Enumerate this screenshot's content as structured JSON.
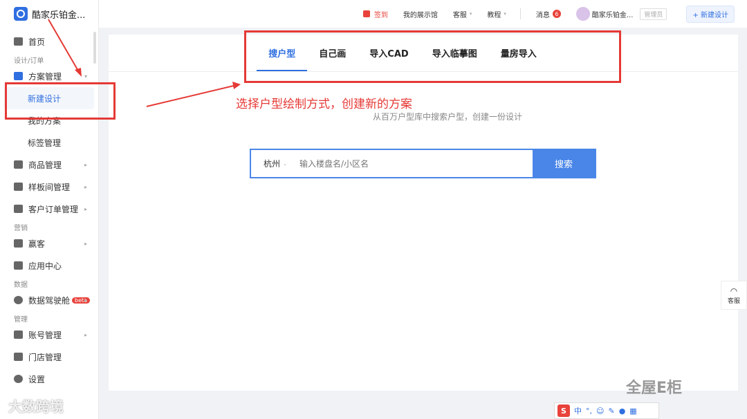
{
  "sidebar": {
    "brand": "酷家乐铂金...",
    "home": "首页",
    "group_design": "设计/订单",
    "plan_mgmt": "方案管理",
    "new_design": "新建设计",
    "my_plans": "我的方案",
    "tag_mgmt": "标签管理",
    "goods_mgmt": "商品管理",
    "sample_mgmt": "样板间管理",
    "customer_orders": "客户订单管理",
    "group_marketing": "营销",
    "yingke": "赢客",
    "app_center": "应用中心",
    "group_data": "数据",
    "data_cockpit": "数据驾驶舱",
    "beta": "beta",
    "group_manage": "管理",
    "account_mgmt": "账号管理",
    "store_mgmt": "门店管理",
    "settings": "设置"
  },
  "topbar": {
    "checkin": "签到",
    "showroom": "我的展示馆",
    "support": "客服",
    "tutorial": "教程",
    "messages": "消息",
    "message_count": "6",
    "user": "酷家乐铂金...",
    "role": "管理员",
    "new_design": "+ 新建设计"
  },
  "tabs": [
    "搜户型",
    "自己画",
    "导入CAD",
    "导入临摹图",
    "量房导入"
  ],
  "subtitle": "从百万户型库中搜索户型，创建一份设计",
  "search": {
    "city": "杭州",
    "placeholder": "输入楼盘名/小区名",
    "button": "搜索"
  },
  "annotation": "选择户型绘制方式，创建新的方案",
  "float_support": "客服",
  "ime": {
    "lang": "中"
  },
  "watermark_left": "大数跨境",
  "watermark_right": "全屋E柜",
  "colors": {
    "accent": "#2f6fe0",
    "annotation_red": "#e53935",
    "search_blue": "#4a86e8"
  }
}
